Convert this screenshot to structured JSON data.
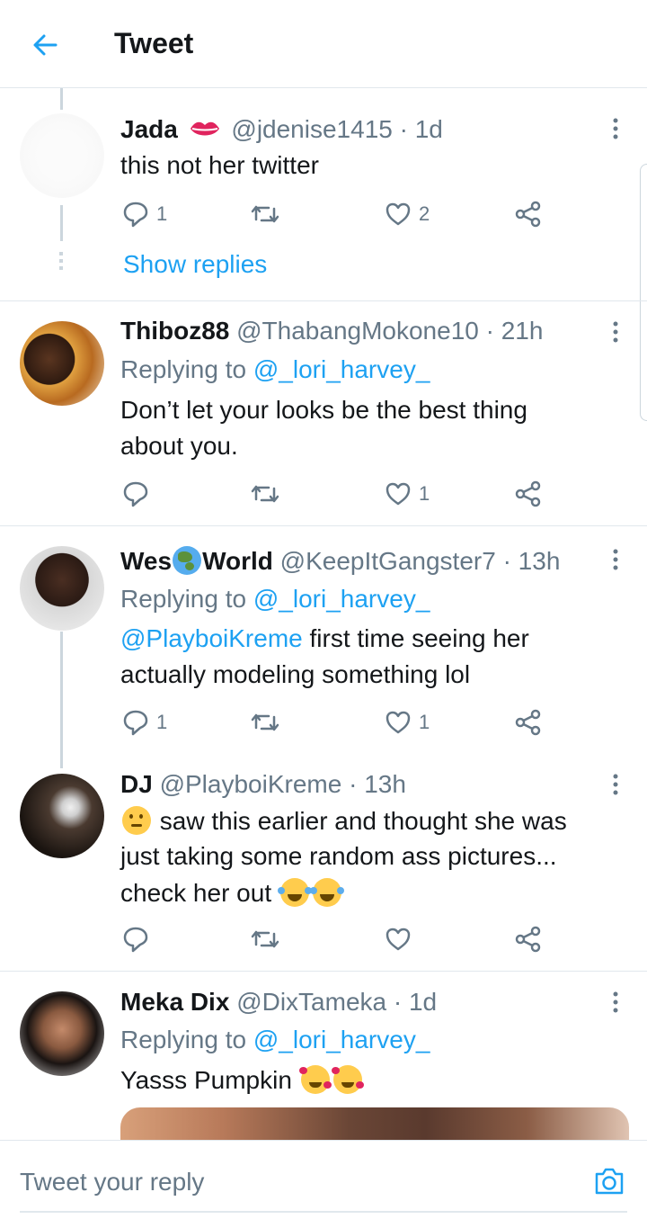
{
  "header": {
    "title": "Tweet"
  },
  "tweets": [
    {
      "name": "Jada",
      "handle": "@jdenise1415",
      "time": "· 1d",
      "lines": [
        "this not her twitter"
      ],
      "reply_count": "1",
      "like_count": "2",
      "show_replies": "Show replies"
    },
    {
      "name": "Thiboz88",
      "handle": "@ThabangMokone10",
      "time": "· 21h",
      "replying_prefix": "Replying to",
      "replying_to": "@_lori_harvey_",
      "lines": [
        "Don’t let your looks be the best thing",
        "about you."
      ],
      "reply_count": "",
      "like_count": "1"
    },
    {
      "name_part1": "Wes",
      "name_part2": "World",
      "handle": "@KeepItGangster7",
      "time": "· 13h",
      "replying_prefix": "Replying to",
      "replying_to": "@_lori_harvey_",
      "mention": "@PlayboiKreme",
      "lines": [
        " first time seeing her",
        "actually modeling something lol"
      ],
      "reply_count": "1",
      "like_count": "1"
    },
    {
      "name": "DJ",
      "handle": "@PlayboiKreme",
      "time": "· 13h",
      "lines": [
        "saw this earlier and thought she was",
        "just taking some random ass pictures...",
        "check her out"
      ],
      "reply_count": "",
      "like_count": ""
    },
    {
      "name": "Meka Dix",
      "handle": "@DixTameka",
      "time": "· 1d",
      "replying_prefix": "Replying to",
      "replying_to": "@_lori_harvey_",
      "lines": [
        "Yasss Pumpkin"
      ]
    }
  ],
  "reply_bar": {
    "placeholder": "Tweet your reply"
  },
  "colors": {
    "accent": "#1da1f2",
    "secondary_text": "#657786",
    "divider": "#e1e8ed"
  },
  "icons": [
    "back-arrow-icon",
    "more-vert-icon",
    "reply-icon",
    "retweet-icon",
    "like-icon",
    "share-icon",
    "camera-icon"
  ]
}
